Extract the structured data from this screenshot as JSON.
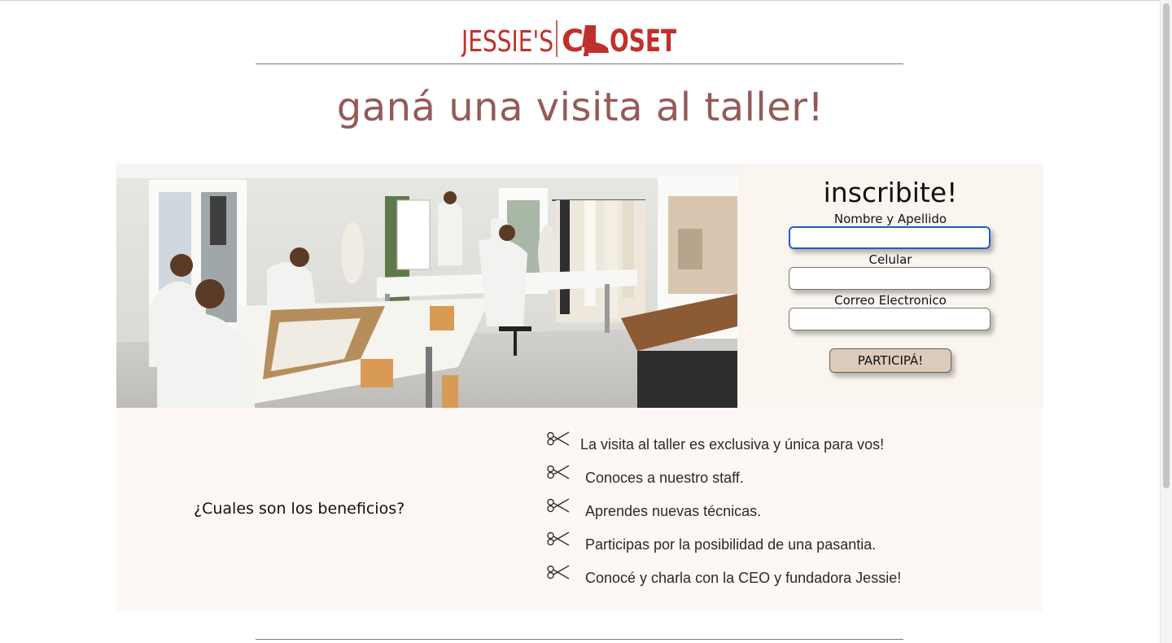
{
  "brand": {
    "name_part1": "JESSIE'S",
    "name_c": "C",
    "name_part2": "OSET",
    "color": "#c0312b"
  },
  "headline": "ganá una visita al taller!",
  "photo": {
    "subject": "sewing workshop with staff at tables"
  },
  "form": {
    "title": "inscribite!",
    "name_label": "Nombre y Apellido",
    "name_value": "",
    "phone_label": "Celular",
    "phone_value": "",
    "email_label": "Correo Electronico",
    "email_value": "",
    "submit_label": "PARTICIPÁ!"
  },
  "benefits": {
    "heading": "¿Cuales son los beneficios?",
    "icon": "scissors-icon",
    "items": [
      "La visita al taller es exclusiva y única para vos!",
      "Conoces a nuestro staff.",
      "Aprendes nuevas técnicas.",
      "Participas por la posibilidad de una pasantia.",
      "Conocé y charla con la CEO y fundadora Jessie!"
    ]
  },
  "colors": {
    "headline": "#955a58",
    "form_background": "#faf5ef",
    "benefits_background": "#fdf8f5",
    "button": "#dccbbb"
  }
}
